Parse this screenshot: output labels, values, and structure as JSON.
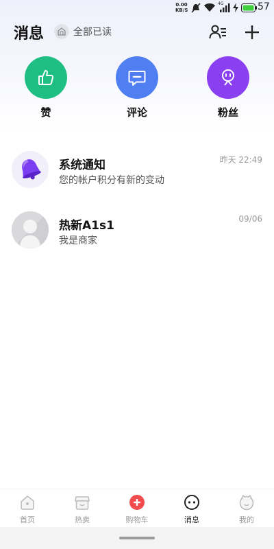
{
  "status_bar": {
    "speed_value": "0.00",
    "speed_unit": "KB/S",
    "network_label": "4G",
    "battery": "57"
  },
  "header": {
    "title": "消息",
    "mark_all_read": "全部已读"
  },
  "quick_entries": [
    {
      "label": "赞",
      "icon": "thumbs-up-icon",
      "color": "#1fbf84"
    },
    {
      "label": "评论",
      "icon": "comment-icon",
      "color": "#4f7ff0"
    },
    {
      "label": "粉丝",
      "icon": "fans-icon",
      "color": "#8a3ff0"
    }
  ],
  "conversations": [
    {
      "name": "系统通知",
      "preview": "您的帐户积分有新的变动",
      "time": "昨天 22:49",
      "avatar": "bell-icon"
    },
    {
      "name": "热新A1s1",
      "preview": "我是商家",
      "time": "09/06",
      "avatar": "default-avatar"
    }
  ],
  "tabbar": {
    "items": [
      {
        "label": "首页",
        "icon": "home-icon",
        "active": false
      },
      {
        "label": "热卖",
        "icon": "shop-icon",
        "active": false
      },
      {
        "label": "购物车",
        "icon": "cart-plus-icon",
        "active": false
      },
      {
        "label": "消息",
        "icon": "message-icon",
        "active": true
      },
      {
        "label": "我的",
        "icon": "profile-icon",
        "active": false
      }
    ]
  },
  "colors": {
    "accent_red": "#f04c4c",
    "battery_green": "#3ecf3e"
  }
}
